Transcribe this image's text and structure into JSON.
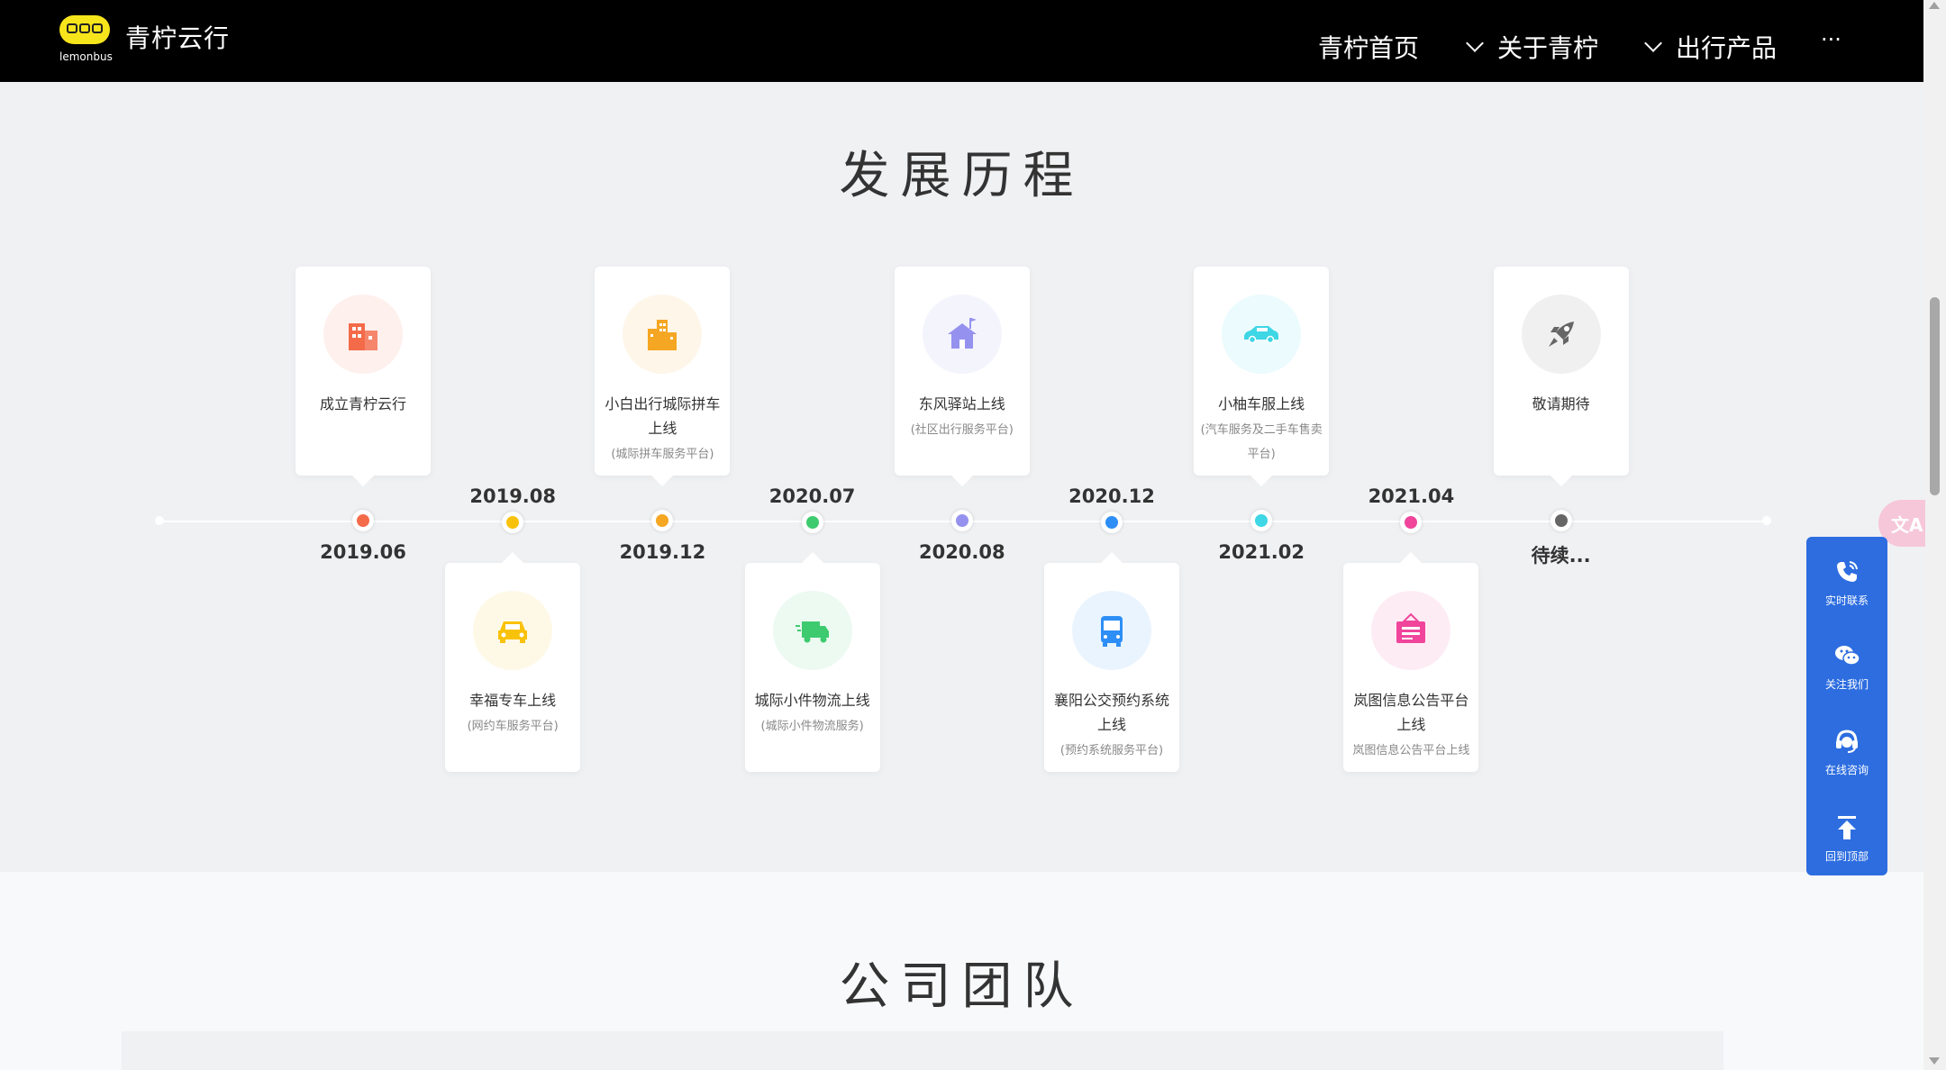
{
  "nav": {
    "brand": "青柠云行",
    "brand_sub": "lemonbus",
    "items": [
      {
        "label": "青柠首页"
      },
      {
        "label": "关于青柠"
      },
      {
        "label": "出行产品"
      }
    ],
    "more": "···"
  },
  "history": {
    "title": "发展历程",
    "events": [
      {
        "date": "2019.06",
        "title": "成立青柠云行",
        "sub": "",
        "color": "#f46b4a",
        "icon": "building-icon"
      },
      {
        "date": "2019.08",
        "title": "幸福专车上线",
        "sub": "(网约车服务平台)",
        "color": "#f9c20a",
        "icon": "car-icon"
      },
      {
        "date": "2019.12",
        "title": "小白出行城际拼车上线",
        "sub": "(城际拼车服务平台)",
        "color": "#f5a623",
        "icon": "city-buildings-icon"
      },
      {
        "date": "2020.07",
        "title": "城际小件物流上线",
        "sub": "(城际小件物流服务)",
        "color": "#3ecb6f",
        "icon": "truck-icon"
      },
      {
        "date": "2020.08",
        "title": "东风驿站上线",
        "sub": "(社区出行服务平台)",
        "color": "#9592ef",
        "icon": "house-flag-icon"
      },
      {
        "date": "2020.12",
        "title": "襄阳公交预约系统上线",
        "sub": "(预约系统服务平台)",
        "color": "#2d8ef5",
        "icon": "bus-icon"
      },
      {
        "date": "2021.02",
        "title": "小柚车服上线",
        "sub": "(汽车服务及二手车售卖平台)",
        "color": "#3fd6e6",
        "icon": "sedan-icon"
      },
      {
        "date": "2021.04",
        "title": "岚图信息公告平台上线",
        "sub": "岚图信息公告平台上线",
        "color": "#f0459b",
        "icon": "notice-board-icon"
      },
      {
        "date": "待续...",
        "title": "敬请期待",
        "sub": "",
        "color": "#666666",
        "icon": "rocket-icon"
      }
    ]
  },
  "team": {
    "title": "公司团队"
  },
  "side": {
    "items": [
      {
        "label": "实时联系",
        "icon": "phone-icon"
      },
      {
        "label": "关注我们",
        "icon": "wechat-icon"
      },
      {
        "label": "在线咨询",
        "icon": "headset-icon"
      },
      {
        "label": "回到顶部",
        "icon": "back-to-top-icon"
      }
    ],
    "translate": "文A"
  },
  "colors": {
    "nav_bg": "#000000",
    "accent_blue": "#2d6de0",
    "logo_yellow": "#f7e51c"
  }
}
